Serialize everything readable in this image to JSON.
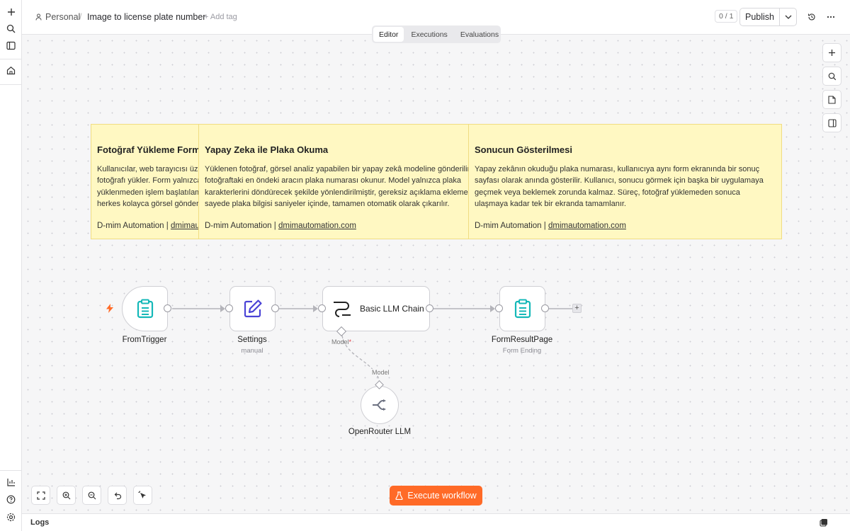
{
  "header": {
    "breadcrumb_personal": "Personal",
    "breadcrumb_separator": "/",
    "workflow_title": "Image to license plate number",
    "add_tag": "+ Add tag",
    "counter": "0 / 1",
    "publish_label": "Publish"
  },
  "tabs": [
    "Editor",
    "Executions",
    "Evaluations"
  ],
  "active_tab": "Editor",
  "sticky_notes": [
    {
      "title": "Fotoğraf Yükleme Formu",
      "lines": [
        "Kullanıcılar, web tarayıcısı üzerinden",
        "fotoğrafı yükler. Form yalnızca",
        "yüklenmeden işlem başlatılamaz,",
        "herkes kolayca görsel gönderebilir."
      ],
      "footer_prefix": "D-mim Automation | ",
      "footer_link": "dmimautomation.com"
    },
    {
      "title": "Yapay Zeka ile Plaka Okuma",
      "lines": [
        "Yüklenen fotoğraf, görsel analiz yapabilen bir yapay zekâ modeline gönderilir.",
        "fotoğraftaki en öndeki aracın plaka numarası okunur. Model yalnızca plaka",
        "karakterlerini döndürecek şekilde yönlendirilmiştir, gereksiz açıklama eklemez.",
        "sayede plaka bilgisi saniyeler içinde, tamamen otomatik olarak çıkarılır."
      ],
      "footer_prefix": "D-mim Automation | ",
      "footer_link": "dmimautomation.com"
    },
    {
      "title": "Sonucun Gösterilmesi",
      "lines": [
        "Yapay zekânın okuduğu plaka numarası, kullanıcıya aynı form ekranında bir sonuç",
        "sayfası olarak anında gösterilir. Kullanıcı, sonucu görmek için başka bir uygulamaya",
        "geçmek veya beklemek zorunda kalmaz. Süreç, fotoğraf yüklemeden sonuca",
        "ulaşmaya kadar tek bir ekranda tamamlanır."
      ],
      "footer_prefix": "D-mim Automation | ",
      "footer_link": "dmimautomation.com"
    }
  ],
  "nodes": {
    "form_trigger": {
      "name": "FromTrigger",
      "icon": "clipboard-icon"
    },
    "settings": {
      "name": "Settings",
      "subtitle": "manual",
      "icon": "pencil-square-icon"
    },
    "llm_chain": {
      "name": "Basic LLM Chain",
      "icon": "chain-icon",
      "port_label": "Model",
      "required_mark": "*"
    },
    "form_result": {
      "name": "FormResultPage",
      "subtitle": "Form Ending",
      "icon": "clipboard-icon"
    },
    "openrouter": {
      "name": "OpenRouter LLM",
      "icon": "openrouter-icon",
      "connection_label": "Model"
    }
  },
  "footer": {
    "execute_label": "Execute workflow",
    "logs_label": "Logs"
  },
  "colors": {
    "accent": "#ff6a27",
    "sticky": "#fff8c2",
    "node_icon_teal": "#14b8b8",
    "node_icon_indigo": "#4b44d6"
  }
}
